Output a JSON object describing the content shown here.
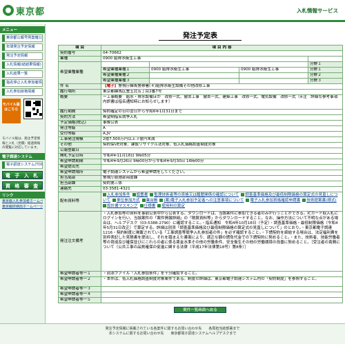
{
  "header": {
    "logo": "東京都",
    "service": "入札情報サービス"
  },
  "sidebar": {
    "menu_head": "メニュー",
    "items": [
      "東京都公報号例案確公告",
      "年間発注予定情報",
      "発注予定情報",
      "入札情報(結結果情報)",
      "入札結果一覧",
      "指名停止入札参加者情報",
      "入札参加資格情報"
    ],
    "mobile_badge": "モバイル版はこちら",
    "mobile_text": "モバイル版は、発注予定情報と入札（見積）経過情報の閲覧に対応しています。",
    "sys_head": "電子調達システム",
    "sys_items": [
      "電子調達システム(TOP)",
      "電 子 入 札",
      "資 格 審 査"
    ],
    "links_head": "リンク",
    "links": [
      "東京都入札参加者ホームページ",
      "東京都財務局ホームページ"
    ]
  },
  "main": {
    "title": "発注予定表",
    "col_item": "項 目",
    "col_content": "項 目 内 容",
    "rows": [
      {
        "label": "契約番号",
        "value": "04-70662"
      },
      {
        "label": "業種",
        "value": "0900 給排水衛生工事"
      },
      {
        "label": "業種(2)",
        "value": ""
      }
    ],
    "hope": {
      "label": "希望業種業種",
      "r1": "希望業種業種１",
      "r1v": "0900 給排水衛生工事",
      "r1b": "0900 給排水衛生工事",
      "r1s": "分野１",
      "r2": "希望業種業種２",
      "r2s": "分野２",
      "r3": "希望業種業種３",
      "r3s": "分野３"
    },
    "name_label": "件 名",
    "name_tag": "【電子】",
    "name_value": "警視庁練馬警察署(４)給排水衛生設備その他改修工事",
    "place_label": "履行場所",
    "place_value": "東京都練馬区豊玉北五丁目2番7号",
    "gaiyo_label": "概要",
    "gaiyo_value": "ー工事概要　給水・排水設備ほか　改修一式、撤去工事　撤去一式、建築工事　改修一式、電気設備　改修一式（※注　詳細な参考事項内訳書は指名通知時にお知らせします）",
    "rows2": [
      {
        "label": "履行期間",
        "value": "契約確定の日の翌日から令和6年1月31日まで"
      },
      {
        "label": "契約方法",
        "value": "希望制指名競争入札"
      },
      {
        "label": "予定価格(税込)",
        "value": "事後公表"
      },
      {
        "label": "発注等級",
        "value": "A"
      },
      {
        "label": "受付等級",
        "value": "A,JV"
      },
      {
        "label": "工事発注規模",
        "value": "2億7,500万円以上３億円未満"
      },
      {
        "label": "その他",
        "value": "契約保VE対象、建設リサイクル法対象、低入札価格調査制度対象"
      },
      {
        "label": "公報登載日",
        "value": ""
      },
      {
        "label": "開札予定日時",
        "value": "令和4年11月18日 9時05分"
      },
      {
        "label": "希望申請期間",
        "value": "令和4年9月26日 9時00分から令和4年9月30日 16時00分"
      },
      {
        "label": "希望提出先",
        "value": ""
      },
      {
        "label": "希望申請場所",
        "value": "電子調達システムから希望申請をしてください。"
      },
      {
        "label": "担当局部",
        "value": "警視庁経理部用度課"
      },
      {
        "label": "担当部課",
        "value": "契約第三係"
      },
      {
        "label": "連絡先",
        "value": "03-3581-4321"
      }
    ],
    "docs_label": "配布資料等",
    "docs": [
      "入札参加条件",
      "設置書",
      "監理技術者等の資格又は履歴関係の確認について",
      "調査基準価格及び最低制限価格の算定式の見直しについて",
      "単位参加方式",
      "業台帳",
      "(案)電子入札参加予定者への注意事項について",
      "電子入札参加資格確認申請書",
      "技術提案書(様式)",
      "設計書マスキング",
      "仕様書",
      "使用料の算定"
    ],
    "note_label": "発注注文備考",
    "note_value": "・入札参加等の資料を事前公表中から公表する。ダウンロードは、当該案件に参加できる者のみが行うことができる。ICカード取入札にログインを行い、当該案件の「案件情報詳細」の「積算資料等」からダウンロードすること。なお、操作方法について不明な点がある場合は、ヘルプデスク（03-5388-2790）に確認すること。・指名通知　令和4年10月18日（予定）・調査基準価格・最低制限価格（令和4年5月31日改正）で算定する。詳細は別添「調査基準価格及び最低制限価格の算定式の見直しについて」のとおり。・東京都電子調達1216・契約制度に掲載されている「工事調査等競争入札参加者の件」を必ず確認すること。・下請契約を締結する場合は、法定福利費を別枠表記した見積書を提出し、それを踏まえた書面により、適正な額の請負代金での下請契約に努めること。・また、技術者、技能労働者等の育成及び確保並びにこれらの者に係る賃金水準その他の労働条件、安全衛生その他の労働環境の改善に努めること。［受注者の責務について（公共工事の品質確保の促進に関する法律（平成17年法律第18号）第8条）］",
    "rows3": [
      {
        "label": "希望申請者等一１",
        "value": "・別添ファイル「入札参加条件」を十分確認すること。"
      },
      {
        "label": "希望申請者等一２",
        "value": "・本件は、低入札価格調査制度対象案件である。制度の詳細は、東京都電子調達システム内の「契約制度」を参照すること。"
      },
      {
        "label": "希望申請者等一３",
        "value": ""
      },
      {
        "label": "希望申請者等一４",
        "value": ""
      },
      {
        "label": "希望申請者等一５",
        "value": ""
      }
    ],
    "back_button": "案件一覧画面へ戻る"
  },
  "footer": {
    "line1": "発注予定情報に掲載されている各案件に関するお問い合わせ先　　各局担当結部署まで",
    "line2": "本システムに関するお問い合わせ先　　東京都電子調達システムヘルプデスクまで"
  }
}
